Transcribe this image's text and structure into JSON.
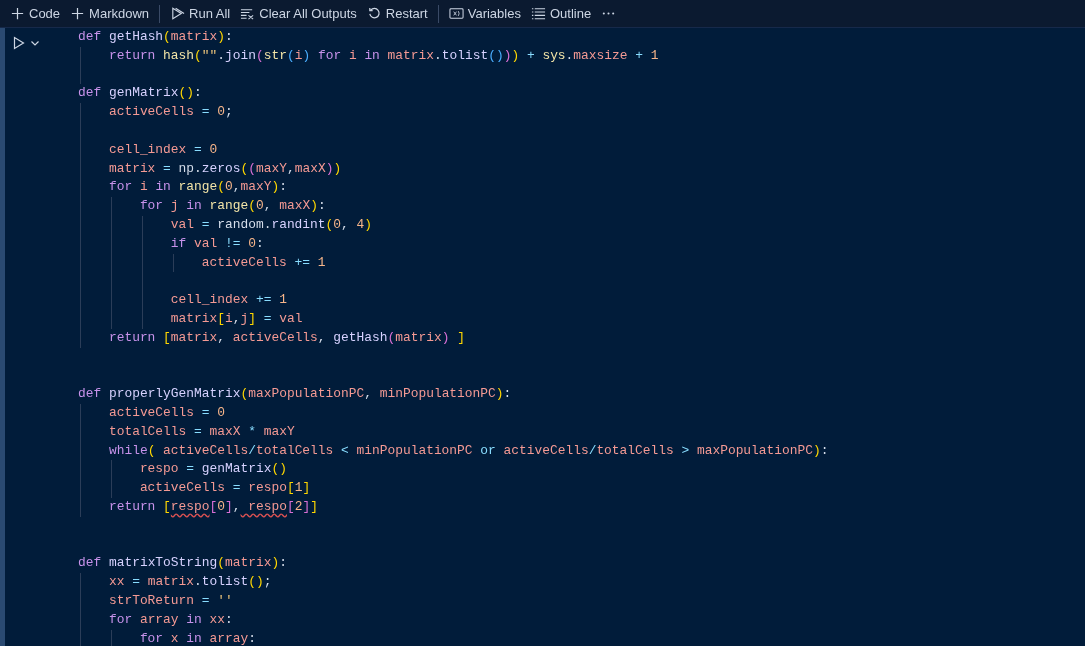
{
  "toolbar": {
    "groups": [
      [
        {
          "kind": "add",
          "label": "Code"
        },
        {
          "kind": "add",
          "label": "Markdown"
        }
      ],
      [
        {
          "kind": "run-all",
          "label": "Run All"
        },
        {
          "kind": "clear",
          "label": "Clear All Outputs"
        },
        {
          "kind": "restart",
          "label": "Restart"
        }
      ],
      [
        {
          "kind": "variables",
          "label": "Variables"
        },
        {
          "kind": "outline",
          "label": "Outline"
        },
        {
          "kind": "more"
        }
      ]
    ]
  },
  "cell": {
    "lines": [
      {
        "kind": "code",
        "tokens": [
          {
            "kind": "kw",
            "text": "def"
          },
          {
            "kind": "fn",
            "text": " getHash"
          },
          {
            "kind": "b1",
            "text": "("
          },
          {
            "kind": "var",
            "text": "matrix"
          },
          {
            "kind": "b1",
            "text": ")"
          },
          {
            "kind": "p",
            "text": ":"
          }
        ],
        "children": [
          {
            "kind": "code",
            "tokens": [
              {
                "kind": "kw",
                "text": "return"
              },
              {
                "kind": "bi",
                "text": " hash"
              },
              {
                "kind": "b1",
                "text": "("
              },
              {
                "kind": "str",
                "text": "\"\""
              },
              {
                "kind": "p",
                "text": "."
              },
              {
                "kind": "fn",
                "text": "join"
              },
              {
                "kind": "b2",
                "text": "("
              },
              {
                "kind": "bi",
                "text": "str"
              },
              {
                "kind": "b3",
                "text": "("
              },
              {
                "kind": "var",
                "text": "i"
              },
              {
                "kind": "b3",
                "text": ")"
              },
              {
                "kind": "kw",
                "text": " for"
              },
              {
                "kind": "var",
                "text": " i"
              },
              {
                "kind": "kw",
                "text": " in"
              },
              {
                "kind": "var",
                "text": " matrix"
              },
              {
                "kind": "p",
                "text": "."
              },
              {
                "kind": "fn",
                "text": "tolist"
              },
              {
                "kind": "b3",
                "text": "()"
              },
              {
                "kind": "b2",
                "text": ")"
              },
              {
                "kind": "b1",
                "text": ")"
              },
              {
                "kind": "op",
                "text": " +"
              },
              {
                "kind": "bi",
                "text": " sys"
              },
              {
                "kind": "p",
                "text": "."
              },
              {
                "kind": "var",
                "text": "maxsize"
              },
              {
                "kind": "op",
                "text": " +"
              },
              {
                "kind": "num",
                "text": " 1"
              }
            ]
          },
          {
            "kind": "blank"
          }
        ]
      },
      {
        "kind": "code",
        "tokens": [
          {
            "kind": "kw",
            "text": "def"
          },
          {
            "kind": "fn",
            "text": " genMatrix"
          },
          {
            "kind": "b1",
            "text": "()"
          },
          {
            "kind": "p",
            "text": ":"
          }
        ],
        "children": [
          {
            "kind": "code",
            "tokens": [
              {
                "kind": "var",
                "text": "activeCells"
              },
              {
                "kind": "op",
                "text": " ="
              },
              {
                "kind": "num",
                "text": " 0"
              },
              {
                "kind": "p",
                "text": ";"
              }
            ]
          },
          {
            "kind": "blank"
          },
          {
            "kind": "code",
            "tokens": [
              {
                "kind": "var",
                "text": "cell_index"
              },
              {
                "kind": "op",
                "text": " ="
              },
              {
                "kind": "num",
                "text": " 0"
              }
            ]
          },
          {
            "kind": "code",
            "tokens": [
              {
                "kind": "var",
                "text": "matrix"
              },
              {
                "kind": "op",
                "text": " ="
              },
              {
                "kind": "p",
                "text": " np."
              },
              {
                "kind": "fn",
                "text": "zeros"
              },
              {
                "kind": "b1",
                "text": "("
              },
              {
                "kind": "b2",
                "text": "("
              },
              {
                "kind": "var",
                "text": "maxY"
              },
              {
                "kind": "p",
                "text": ","
              },
              {
                "kind": "var",
                "text": "maxX"
              },
              {
                "kind": "b2",
                "text": ")"
              },
              {
                "kind": "b1",
                "text": ")"
              }
            ]
          },
          {
            "kind": "code",
            "tokens": [
              {
                "kind": "kw",
                "text": "for"
              },
              {
                "kind": "var",
                "text": " i"
              },
              {
                "kind": "kw",
                "text": " in"
              },
              {
                "kind": "bi",
                "text": " range"
              },
              {
                "kind": "b1",
                "text": "("
              },
              {
                "kind": "num",
                "text": "0"
              },
              {
                "kind": "p",
                "text": ","
              },
              {
                "kind": "var",
                "text": "maxY"
              },
              {
                "kind": "b1",
                "text": ")"
              },
              {
                "kind": "p",
                "text": ":"
              }
            ],
            "children": [
              {
                "kind": "code",
                "tokens": [
                  {
                    "kind": "kw",
                    "text": "for"
                  },
                  {
                    "kind": "var",
                    "text": " j"
                  },
                  {
                    "kind": "kw",
                    "text": " in"
                  },
                  {
                    "kind": "bi",
                    "text": " range"
                  },
                  {
                    "kind": "b1",
                    "text": "("
                  },
                  {
                    "kind": "num",
                    "text": "0"
                  },
                  {
                    "kind": "p",
                    "text": ","
                  },
                  {
                    "kind": "var",
                    "text": " maxX"
                  },
                  {
                    "kind": "b1",
                    "text": ")"
                  },
                  {
                    "kind": "p",
                    "text": ":"
                  }
                ],
                "children": [
                  {
                    "kind": "code",
                    "tokens": [
                      {
                        "kind": "var",
                        "text": "val"
                      },
                      {
                        "kind": "op",
                        "text": " ="
                      },
                      {
                        "kind": "p",
                        "text": " random."
                      },
                      {
                        "kind": "fn",
                        "text": "randint"
                      },
                      {
                        "kind": "b1",
                        "text": "("
                      },
                      {
                        "kind": "num",
                        "text": "0"
                      },
                      {
                        "kind": "p",
                        "text": ","
                      },
                      {
                        "kind": "num",
                        "text": " 4"
                      },
                      {
                        "kind": "b1",
                        "text": ")"
                      }
                    ]
                  },
                  {
                    "kind": "code",
                    "tokens": [
                      {
                        "kind": "kw",
                        "text": "if"
                      },
                      {
                        "kind": "var",
                        "text": " val"
                      },
                      {
                        "kind": "op",
                        "text": " !="
                      },
                      {
                        "kind": "num",
                        "text": " 0"
                      },
                      {
                        "kind": "p",
                        "text": ":"
                      }
                    ],
                    "children": [
                      {
                        "kind": "code",
                        "tokens": [
                          {
                            "kind": "var",
                            "text": "activeCells"
                          },
                          {
                            "kind": "op",
                            "text": " +="
                          },
                          {
                            "kind": "num",
                            "text": " 1"
                          }
                        ]
                      }
                    ]
                  },
                  {
                    "kind": "blank"
                  },
                  {
                    "kind": "code",
                    "tokens": [
                      {
                        "kind": "var",
                        "text": "cell_index"
                      },
                      {
                        "kind": "op",
                        "text": " +="
                      },
                      {
                        "kind": "num",
                        "text": " 1"
                      }
                    ]
                  },
                  {
                    "kind": "code",
                    "tokens": [
                      {
                        "kind": "var",
                        "text": "matrix"
                      },
                      {
                        "kind": "b1",
                        "text": "["
                      },
                      {
                        "kind": "var",
                        "text": "i"
                      },
                      {
                        "kind": "p",
                        "text": ","
                      },
                      {
                        "kind": "var",
                        "text": "j"
                      },
                      {
                        "kind": "b1",
                        "text": "]"
                      },
                      {
                        "kind": "op",
                        "text": " ="
                      },
                      {
                        "kind": "var",
                        "text": " val"
                      }
                    ]
                  }
                ]
              }
            ]
          },
          {
            "kind": "code",
            "tokens": [
              {
                "kind": "kw",
                "text": "return"
              },
              {
                "kind": "b1",
                "text": " ["
              },
              {
                "kind": "var",
                "text": "matrix"
              },
              {
                "kind": "p",
                "text": ","
              },
              {
                "kind": "var",
                "text": " activeCells"
              },
              {
                "kind": "p",
                "text": ","
              },
              {
                "kind": "fn",
                "text": " getHash"
              },
              {
                "kind": "b2",
                "text": "("
              },
              {
                "kind": "var",
                "text": "matrix"
              },
              {
                "kind": "b2",
                "text": ")"
              },
              {
                "kind": "b1",
                "text": " ]"
              }
            ]
          }
        ]
      },
      {
        "kind": "blank"
      },
      {
        "kind": "blank"
      },
      {
        "kind": "code",
        "tokens": [
          {
            "kind": "kw",
            "text": "def"
          },
          {
            "kind": "fn",
            "text": " properlyGenMatrix"
          },
          {
            "kind": "b1",
            "text": "("
          },
          {
            "kind": "var",
            "text": "maxPopulationPC"
          },
          {
            "kind": "p",
            "text": ","
          },
          {
            "kind": "var",
            "text": " minPopulationPC"
          },
          {
            "kind": "b1",
            "text": ")"
          },
          {
            "kind": "p",
            "text": ":"
          }
        ],
        "children": [
          {
            "kind": "code",
            "tokens": [
              {
                "kind": "var",
                "text": "activeCells"
              },
              {
                "kind": "op",
                "text": " ="
              },
              {
                "kind": "num",
                "text": " 0"
              }
            ]
          },
          {
            "kind": "code",
            "tokens": [
              {
                "kind": "var",
                "text": "totalCells"
              },
              {
                "kind": "op",
                "text": " ="
              },
              {
                "kind": "var",
                "text": " maxX"
              },
              {
                "kind": "op",
                "text": " *"
              },
              {
                "kind": "var",
                "text": " maxY"
              }
            ]
          },
          {
            "kind": "code",
            "tokens": [
              {
                "kind": "kw",
                "text": "while"
              },
              {
                "kind": "b1",
                "text": "("
              },
              {
                "kind": "var",
                "text": " activeCells"
              },
              {
                "kind": "op",
                "text": "/"
              },
              {
                "kind": "var",
                "text": "totalCells"
              },
              {
                "kind": "op",
                "text": " <"
              },
              {
                "kind": "var",
                "text": " minPopulationPC"
              },
              {
                "kind": "op",
                "text": " or"
              },
              {
                "kind": "var",
                "text": " activeCells"
              },
              {
                "kind": "op",
                "text": "/"
              },
              {
                "kind": "var",
                "text": "totalCells"
              },
              {
                "kind": "op",
                "text": " >"
              },
              {
                "kind": "var",
                "text": " maxPopulationPC"
              },
              {
                "kind": "b1",
                "text": ")"
              },
              {
                "kind": "p",
                "text": ":"
              }
            ],
            "children": [
              {
                "kind": "code",
                "tokens": [
                  {
                    "kind": "var",
                    "text": "respo"
                  },
                  {
                    "kind": "op",
                    "text": " ="
                  },
                  {
                    "kind": "fn",
                    "text": " genMatrix"
                  },
                  {
                    "kind": "b1",
                    "text": "()"
                  }
                ]
              },
              {
                "kind": "code",
                "tokens": [
                  {
                    "kind": "var",
                    "text": "activeCells"
                  },
                  {
                    "kind": "op",
                    "text": " ="
                  },
                  {
                    "kind": "var",
                    "text": " respo"
                  },
                  {
                    "kind": "b1",
                    "text": "["
                  },
                  {
                    "kind": "num",
                    "text": "1"
                  },
                  {
                    "kind": "b1",
                    "text": "]"
                  }
                ]
              }
            ]
          },
          {
            "kind": "code",
            "tokens": [
              {
                "kind": "kw",
                "text": "return"
              },
              {
                "kind": "b1",
                "text": " ["
              },
              {
                "kind": "err",
                "text": "respo"
              },
              {
                "kind": "b2",
                "text": "["
              },
              {
                "kind": "num",
                "text": "0"
              },
              {
                "kind": "b2",
                "text": "]"
              },
              {
                "kind": "p",
                "text": ","
              },
              {
                "kind": "err",
                "text": " respo"
              },
              {
                "kind": "b2",
                "text": "["
              },
              {
                "kind": "num",
                "text": "2"
              },
              {
                "kind": "b2",
                "text": "]"
              },
              {
                "kind": "b1",
                "text": "]"
              }
            ]
          }
        ]
      },
      {
        "kind": "blank"
      },
      {
        "kind": "blank"
      },
      {
        "kind": "code",
        "tokens": [
          {
            "kind": "kw",
            "text": "def"
          },
          {
            "kind": "fn",
            "text": " matrixToString"
          },
          {
            "kind": "b1",
            "text": "("
          },
          {
            "kind": "var",
            "text": "matrix"
          },
          {
            "kind": "b1",
            "text": ")"
          },
          {
            "kind": "p",
            "text": ":"
          }
        ],
        "children": [
          {
            "kind": "code",
            "tokens": [
              {
                "kind": "var",
                "text": "xx"
              },
              {
                "kind": "op",
                "text": " ="
              },
              {
                "kind": "var",
                "text": " matrix"
              },
              {
                "kind": "p",
                "text": "."
              },
              {
                "kind": "fn",
                "text": "tolist"
              },
              {
                "kind": "b1",
                "text": "()"
              },
              {
                "kind": "p",
                "text": ";"
              }
            ]
          },
          {
            "kind": "code",
            "tokens": [
              {
                "kind": "var",
                "text": "strToReturn"
              },
              {
                "kind": "op",
                "text": " ="
              },
              {
                "kind": "str",
                "text": " ''"
              }
            ]
          },
          {
            "kind": "code",
            "tokens": [
              {
                "kind": "kw",
                "text": "for"
              },
              {
                "kind": "var",
                "text": " array"
              },
              {
                "kind": "kw",
                "text": " in"
              },
              {
                "kind": "var",
                "text": " xx"
              },
              {
                "kind": "p",
                "text": ":"
              }
            ],
            "children": [
              {
                "kind": "code",
                "tokens": [
                  {
                    "kind": "kw",
                    "text": "for"
                  },
                  {
                    "kind": "var",
                    "text": " x"
                  },
                  {
                    "kind": "kw",
                    "text": " in"
                  },
                  {
                    "kind": "var",
                    "text": " array"
                  },
                  {
                    "kind": "p",
                    "text": ":"
                  }
                ]
              }
            ]
          }
        ]
      }
    ]
  }
}
